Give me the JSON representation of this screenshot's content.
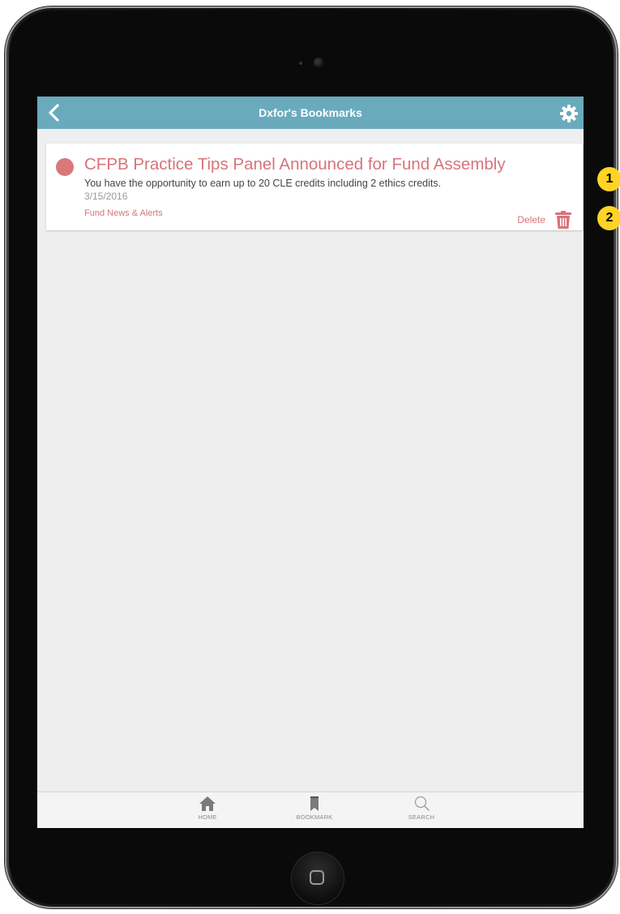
{
  "navbar": {
    "title": "Dxfor's Bookmarks",
    "back_icon": "chevron-left-icon",
    "settings_icon": "gear-icon"
  },
  "bookmark": {
    "title": "CFPB Practice Tips Panel Announced for Fund Assembly",
    "description": "You have the opportunity to earn up to 20 CLE credits including 2 ethics credits.",
    "date": "3/15/2016",
    "category": "Fund News & Alerts",
    "delete_label": "Delete"
  },
  "tabbar": {
    "items": [
      {
        "label": "HOME",
        "icon": "home-icon"
      },
      {
        "label": "BOOKMARK",
        "icon": "bookmark-icon"
      },
      {
        "label": "SEARCH",
        "icon": "search-icon"
      }
    ]
  },
  "callouts": [
    "1",
    "2"
  ],
  "colors": {
    "navbar": "#6aaabd",
    "accent": "#d9737a",
    "callout": "#ffd424",
    "background": "#eeeeee"
  }
}
